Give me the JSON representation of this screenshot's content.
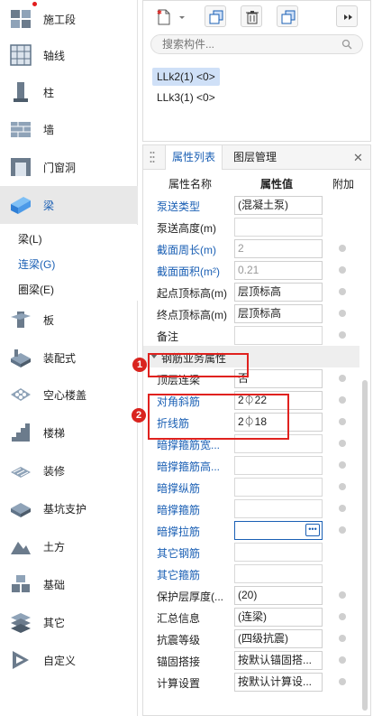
{
  "sidebar": {
    "items": [
      {
        "label": "施工段",
        "icon": "construction-segment-icon"
      },
      {
        "label": "轴线",
        "icon": "grid-axis-icon"
      },
      {
        "label": "柱",
        "icon": "column-icon"
      },
      {
        "label": "墙",
        "icon": "wall-icon"
      },
      {
        "label": "门窗洞",
        "icon": "door-window-icon"
      },
      {
        "label": "梁",
        "icon": "beam-icon"
      },
      {
        "label": "板",
        "icon": "slab-icon"
      },
      {
        "label": "装配式",
        "icon": "prefab-icon"
      },
      {
        "label": "空心楼盖",
        "icon": "hollow-floor-icon"
      },
      {
        "label": "楼梯",
        "icon": "stair-icon"
      },
      {
        "label": "装修",
        "icon": "decoration-icon"
      },
      {
        "label": "基坑支护",
        "icon": "pit-support-icon"
      },
      {
        "label": "土方",
        "icon": "earthwork-icon"
      },
      {
        "label": "基础",
        "icon": "foundation-icon"
      },
      {
        "label": "其它",
        "icon": "other-icon"
      },
      {
        "label": "自定义",
        "icon": "custom-icon"
      }
    ],
    "sub_items": [
      "梁(L)",
      "连梁(G)",
      "圈梁(E)"
    ]
  },
  "component_panel": {
    "search_placeholder": "搜索构件...",
    "components": [
      "LLk2(1) <0>",
      "LLk3(1) <0>"
    ]
  },
  "properties": {
    "tabs": [
      "属性列表",
      "图层管理"
    ],
    "headers": {
      "name": "属性名称",
      "value": "属性值",
      "extra": "附加"
    },
    "rows": [
      {
        "name": "泵送类型",
        "value": "(混凝土泵)",
        "blue": true,
        "att": false
      },
      {
        "name": "泵送高度(m)",
        "value": "",
        "blue": false,
        "att": false
      },
      {
        "name": "截面周长(m)",
        "value": "2",
        "blue": true,
        "att": true,
        "grey": true
      },
      {
        "name": "截面面积(m²)",
        "value": "0.21",
        "blue": true,
        "att": true,
        "grey": true
      },
      {
        "name": "起点顶标高(m)",
        "value": "层顶标高",
        "blue": false,
        "att": true
      },
      {
        "name": "终点顶标高(m)",
        "value": "层顶标高",
        "blue": false,
        "att": true
      },
      {
        "name": "备注",
        "value": "",
        "blue": false,
        "att": true
      }
    ],
    "group_label": "钢筋业务属性",
    "rebar_rows": [
      {
        "name": "顶层连梁",
        "value": "否",
        "blue": false,
        "att": true
      },
      {
        "name": "对角斜筋",
        "value": "2⏀22",
        "blue": true,
        "att": true
      },
      {
        "name": "折线筋",
        "value": "2⏀18",
        "blue": true,
        "att": true
      },
      {
        "name": "暗撑箍筋宽...",
        "value": "",
        "blue": true,
        "att": true
      },
      {
        "name": "暗撑箍筋高...",
        "value": "",
        "blue": true,
        "att": true
      },
      {
        "name": "暗撑纵筋",
        "value": "",
        "blue": true,
        "att": true
      },
      {
        "name": "暗撑箍筋",
        "value": "",
        "blue": true,
        "att": true
      },
      {
        "name": "暗撑拉筋",
        "value": "",
        "blue": true,
        "att": true,
        "editing": true
      },
      {
        "name": "其它钢筋",
        "value": "",
        "blue": true,
        "att": false
      },
      {
        "name": "其它箍筋",
        "value": "",
        "blue": true,
        "att": false
      },
      {
        "name": "保护层厚度(...",
        "value": "(20)",
        "blue": false,
        "att": true
      },
      {
        "name": "汇总信息",
        "value": "(连梁)",
        "blue": false,
        "att": true
      },
      {
        "name": "抗震等级",
        "value": "(四级抗震)",
        "blue": false,
        "att": true
      },
      {
        "name": "锚固搭接",
        "value": "按默认锚固搭...",
        "blue": false,
        "att": true
      },
      {
        "name": "计算设置",
        "value": "按默认计算设...",
        "blue": false,
        "att": true
      }
    ]
  },
  "annotations": {
    "badge1": "1",
    "badge2": "2"
  },
  "colors": {
    "accent": "#1a5fb4",
    "annotation": "#e0221f"
  }
}
